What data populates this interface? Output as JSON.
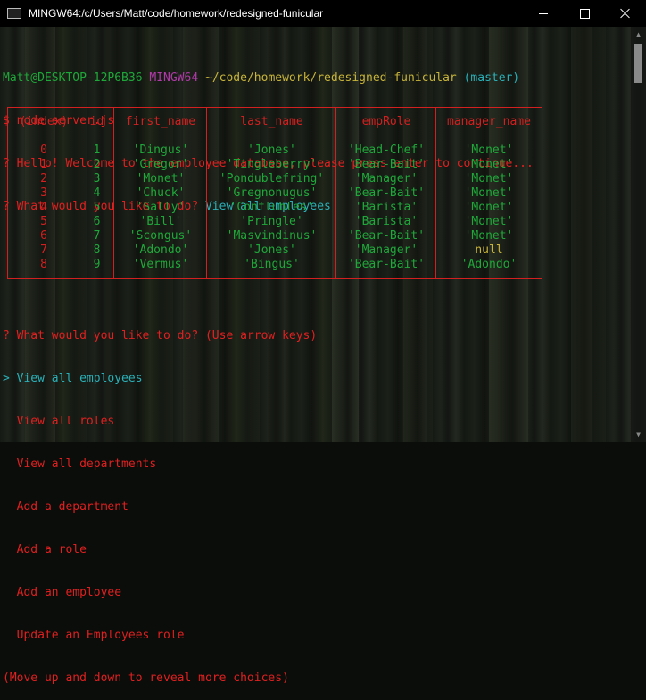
{
  "window": {
    "title": "MINGW64:/c/Users/Matt/code/homework/redesigned-funicular"
  },
  "prompt": {
    "user_host": "Matt@DESKTOP-12P6B36",
    "shell": "MINGW64",
    "path": "~/code/homework/redesigned-funicular",
    "branch": "(master)",
    "command": "$ node server.js"
  },
  "messages": {
    "welcome": "? Hello! Welcome to the employee database, please press enter to continue...",
    "question1": "? What would you like to do?",
    "answer1": "View all employees",
    "question2": "? What would you like to do? (Use arrow keys)"
  },
  "table": {
    "headers": [
      "(index)",
      "id",
      "first_name",
      "last_name",
      "empRole",
      "manager_name"
    ],
    "rows": [
      [
        "0",
        "1",
        "'Dingus'",
        "'Jones'",
        "'Head-Chef'",
        "'Monet'"
      ],
      [
        "1",
        "2",
        "'Gregor'",
        "'Tingleberry'",
        "'Bear-Bait'",
        "'Monet'"
      ],
      [
        "2",
        "3",
        "'Monet'",
        "'Pondublefring'",
        "'Manager'",
        "'Monet'"
      ],
      [
        "3",
        "4",
        "'Chuck'",
        "'Gregnonugus'",
        "'Bear-Bait'",
        "'Monet'"
      ],
      [
        "4",
        "5",
        "'Sally'",
        "'Conflubles'",
        "'Barista'",
        "'Monet'"
      ],
      [
        "5",
        "6",
        "'Bill'",
        "'Pringle'",
        "'Barista'",
        "'Monet'"
      ],
      [
        "6",
        "7",
        "'Scongus'",
        "'Masvindinus'",
        "'Bear-Bait'",
        "'Monet'"
      ],
      [
        "7",
        "8",
        "'Adondo'",
        "'Jones'",
        "'Manager'",
        "null"
      ],
      [
        "8",
        "9",
        "'Vermus'",
        "'Bingus'",
        "'Bear-Bait'",
        "'Adondo'"
      ]
    ]
  },
  "menu": {
    "pointer": ">",
    "items": [
      "View all employees",
      "View all roles",
      "View all departments",
      "Add a department",
      "Add a role",
      "Add an employee",
      "Update an Employees role"
    ],
    "hint": "(Move up and down to reveal more choices)"
  },
  "colors": {
    "prompt_green": "#1fa83a",
    "shell_magenta": "#b03aa8",
    "path_yellow": "#c8b43a",
    "branch_cyan": "#2ab0b8",
    "text_red": "#e02020"
  }
}
